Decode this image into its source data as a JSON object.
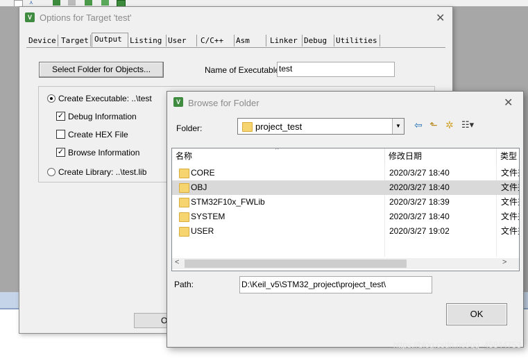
{
  "options_dialog": {
    "title": "Options for Target 'test'",
    "tabs": [
      "Device",
      "Target",
      "Output",
      "Listing",
      "User",
      "C/C++",
      "Asm",
      "Linker",
      "Debug",
      "Utilities"
    ],
    "active_tab": "Output",
    "select_folder_button": "Select Folder for Objects...",
    "name_exec_label": "Name of Executable:",
    "name_exec_value": "test",
    "create_exec_label": "Create Executable:  ..\\test",
    "debug_info_label": "Debug Information",
    "create_hex_label": "Create HEX File",
    "browse_info_label": "Browse Information",
    "create_lib_label": "Create Library:  ..\\test.lib",
    "ok_partial": "OK",
    "checkbox_states": {
      "debug_info": true,
      "create_hex": false,
      "browse_info": true
    },
    "radio_selected": "create_executable"
  },
  "browse_dialog": {
    "title": "Browse for Folder",
    "folder_label": "Folder:",
    "folder_value": "project_test",
    "columns": [
      "名称",
      "修改日期",
      "类型"
    ],
    "rows": [
      {
        "name": "CORE",
        "date": "2020/3/27 18:40",
        "type": "文件夹",
        "selected": false
      },
      {
        "name": "OBJ",
        "date": "2020/3/27 18:40",
        "type": "文件夹",
        "selected": true
      },
      {
        "name": "STM32F10x_FWLib",
        "date": "2020/3/27 18:39",
        "type": "文件夹",
        "selected": false
      },
      {
        "name": "SYSTEM",
        "date": "2020/3/27 18:40",
        "type": "文件夹",
        "selected": false
      },
      {
        "name": "USER",
        "date": "2020/3/27 19:02",
        "type": "文件夹",
        "selected": false
      }
    ],
    "path_label": "Path:",
    "path_value": "D:\\Keil_v5\\STM32_project\\project_test\\",
    "ok_label": "OK"
  },
  "watermark": "https://blog.csdn.net/qq_45844753",
  "colors": {
    "selected_row": "#d9d9d9",
    "dialog_bg": "#f0f0f0",
    "taskbar": "#c5d4e8"
  }
}
